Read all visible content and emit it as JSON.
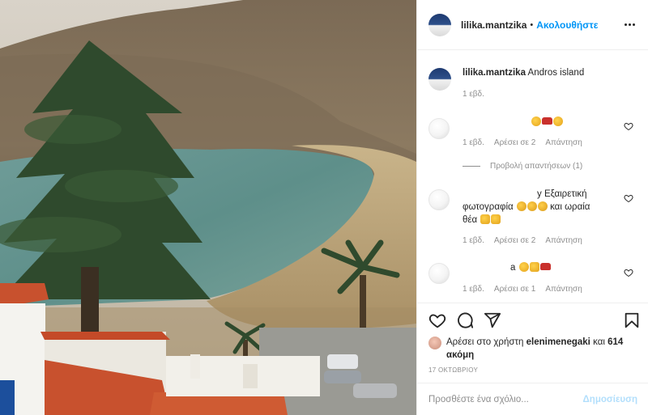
{
  "header": {
    "username": "lilika.mantzika",
    "dot": "•",
    "follow_label": "Ακολουθήστε"
  },
  "caption": {
    "username": "lilika.mantzika",
    "text": "Andros island",
    "time": "1 εβδ."
  },
  "comments": [
    {
      "text": "",
      "time": "1 εβδ.",
      "likes": "Αρέσει σε 2",
      "reply": "Απάντηση",
      "view_replies": "Προβολή απαντήσεων (1)"
    },
    {
      "text_line1": "y Εξαιρετική",
      "text_line2_a": "φωτογραφία",
      "text_line2_b": "και ωραία",
      "text_line3": "θέα",
      "time": "1 εβδ.",
      "likes": "Αρέσει σε 2",
      "reply": "Απάντηση"
    },
    {
      "text": "a",
      "time": "1 εβδ.",
      "likes": "Αρέσει σε 1",
      "reply": "Απάντηση"
    }
  ],
  "likes_summary": {
    "prefix": "Αρέσει στο χρήστη",
    "user": "elenimenegaki",
    "and": "και",
    "count": "614 ακόμη"
  },
  "date": "17 ΟΚΤΩΒΡΙΟΥ",
  "add_comment": {
    "placeholder": "Προσθέστε ένα σχόλιο...",
    "post_label": "Δημοσίευση"
  },
  "colors": {
    "accent": "#0095f6",
    "post_disabled": "#b2dffc",
    "secondary_text": "#8e8e8e"
  },
  "icons": [
    "more-options-icon",
    "heart-icon",
    "comment-icon",
    "share-icon",
    "bookmark-icon"
  ]
}
